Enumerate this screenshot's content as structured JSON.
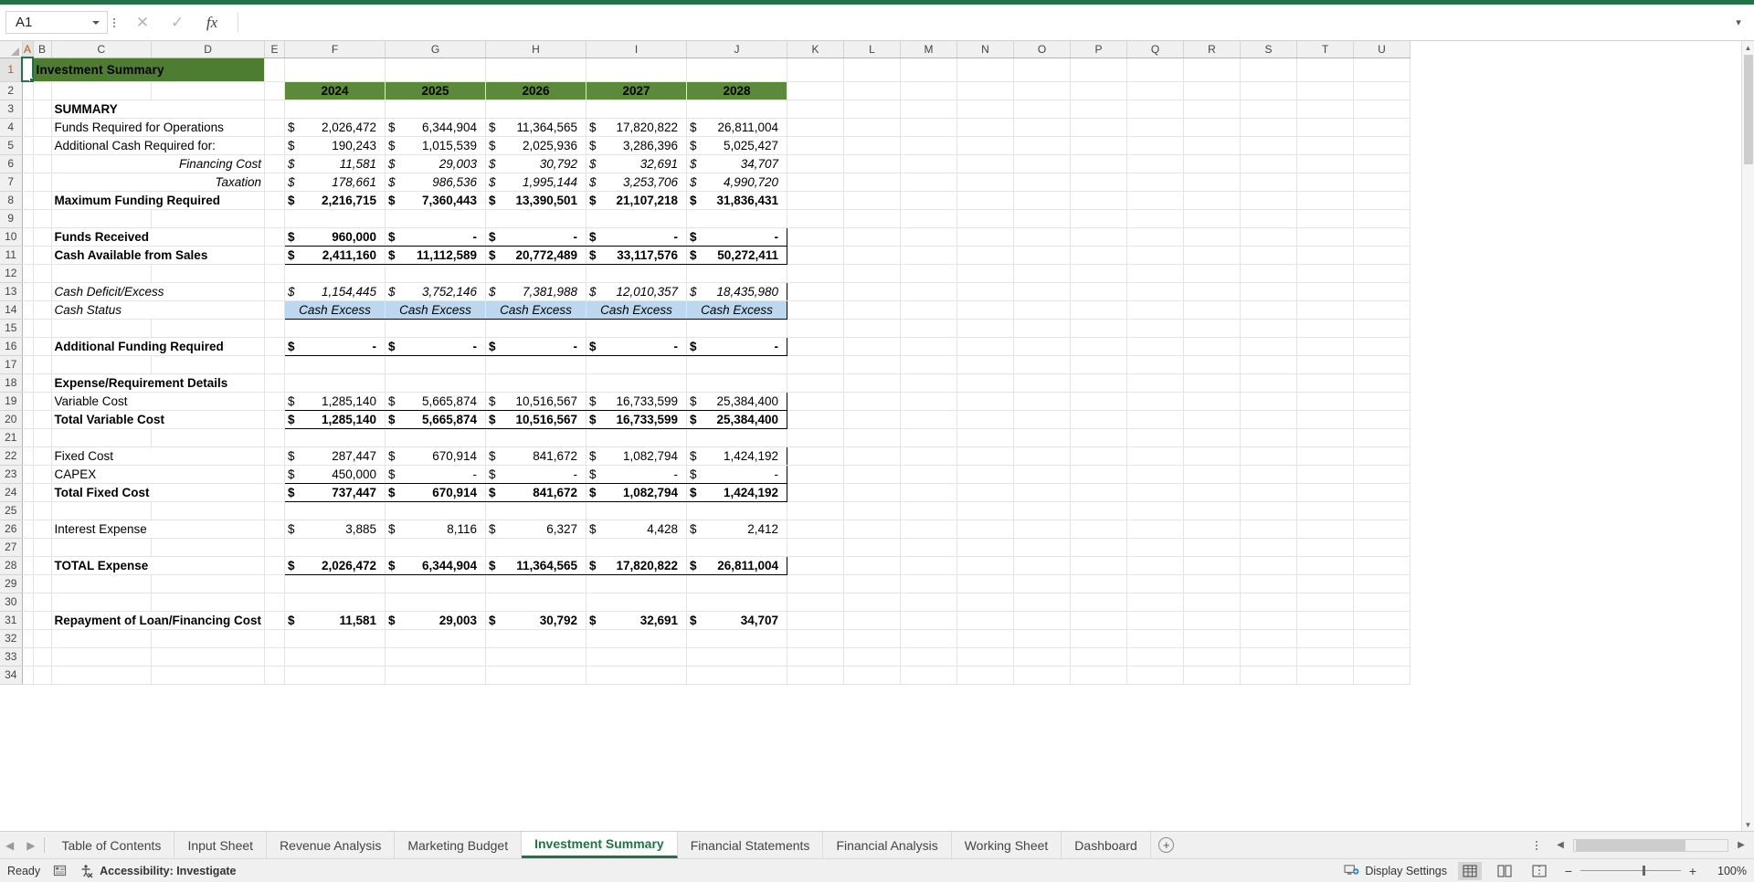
{
  "app": {
    "name_box_value": "A1",
    "formula_value": "",
    "accent_green": "#217346",
    "title_band_green": "#4e7d32",
    "year_band_green": "#5b8b3a",
    "highlight_blue": "#bdd7ee"
  },
  "formula_bar": {
    "cancel_icon": "close-icon",
    "confirm_icon": "check-icon",
    "function_icon": "fx-icon",
    "expand_icon": "chevron-down-icon"
  },
  "columns": [
    "A",
    "B",
    "C",
    "D",
    "E",
    "F",
    "G",
    "H",
    "I",
    "J",
    "K",
    "L",
    "M",
    "N",
    "O",
    "P",
    "Q",
    "R",
    "S",
    "T",
    "U"
  ],
  "rows": [
    1,
    2,
    3,
    4,
    5,
    6,
    7,
    8,
    9,
    10,
    11,
    12,
    13,
    14,
    15,
    16,
    17,
    18,
    19,
    20,
    21,
    22,
    23,
    24,
    25,
    26,
    27,
    28,
    29,
    30,
    31,
    32,
    33,
    34
  ],
  "sheet": {
    "title": "Investment Summary",
    "years": [
      "2024",
      "2025",
      "2026",
      "2027",
      "2028"
    ],
    "sections": [
      {
        "heading": "SUMMARY",
        "rows": [
          {
            "label": "Funds Required for Operations",
            "values": [
              "2,026,472",
              "6,344,904",
              "11,364,565",
              "17,820,822",
              "26,811,004"
            ],
            "style": "normal"
          },
          {
            "label": "Additional Cash Required for:",
            "values": [
              "190,243",
              "1,015,539",
              "2,025,936",
              "3,286,396",
              "5,025,427"
            ],
            "style": "normal"
          },
          {
            "label": "Financing Cost",
            "values": [
              "11,581",
              "29,003",
              "30,792",
              "32,691",
              "34,707"
            ],
            "style": "italic-gray"
          },
          {
            "label": "Taxation",
            "values": [
              "178,661",
              "986,536",
              "1,995,144",
              "3,253,706",
              "4,990,720"
            ],
            "style": "italic-gray"
          },
          {
            "label": "Maximum Funding Required",
            "values": [
              "2,216,715",
              "7,360,443",
              "13,390,501",
              "21,107,218",
              "31,836,431"
            ],
            "style": "bold-total"
          }
        ]
      },
      {
        "heading": "",
        "rows": [
          {
            "label": "Funds Received",
            "values": [
              "960,000",
              "-",
              "-",
              "-",
              "-"
            ],
            "style": "bold-box"
          },
          {
            "label": "Cash Available from Sales",
            "values": [
              "2,411,160",
              "11,112,589",
              "20,772,489",
              "33,117,576",
              "50,272,411"
            ],
            "style": "bold-box"
          }
        ]
      },
      {
        "heading": "",
        "rows": [
          {
            "label": "Cash Deficit/Excess",
            "values": [
              "1,154,445",
              "3,752,146",
              "7,381,988",
              "12,010,357",
              "18,435,980"
            ],
            "style": "italic-gray-box"
          },
          {
            "label": "Cash Status",
            "values": [
              "Cash Excess",
              "Cash Excess",
              "Cash Excess",
              "Cash Excess",
              "Cash Excess"
            ],
            "style": "italic-blue-box"
          }
        ]
      },
      {
        "heading": "",
        "rows": [
          {
            "label": "Additional Funding Required",
            "values": [
              "-",
              "-",
              "-",
              "-",
              "-"
            ],
            "style": "bold-box"
          }
        ]
      },
      {
        "heading": "Expense/Requirement Details",
        "rows": [
          {
            "label": "Variable Cost",
            "values": [
              "1,285,140",
              "5,665,874",
              "10,516,567",
              "16,733,599",
              "25,384,400"
            ],
            "style": "box-top"
          },
          {
            "label": "Total Variable Cost",
            "values": [
              "1,285,140",
              "5,665,874",
              "10,516,567",
              "16,733,599",
              "25,384,400"
            ],
            "style": "bold-box-bottom"
          }
        ]
      },
      {
        "heading": "",
        "rows": [
          {
            "label": "Fixed Cost",
            "values": [
              "287,447",
              "670,914",
              "841,672",
              "1,082,794",
              "1,424,192"
            ],
            "style": "box-top"
          },
          {
            "label": "CAPEX",
            "values": [
              "450,000",
              "-",
              "-",
              "-",
              "-"
            ],
            "style": "box-mid"
          },
          {
            "label": "Total Fixed Cost",
            "values": [
              "737,447",
              "670,914",
              "841,672",
              "1,082,794",
              "1,424,192"
            ],
            "style": "bold-box-bottom"
          }
        ]
      },
      {
        "heading": "",
        "rows": [
          {
            "label": "Interest Expense",
            "values": [
              "3,885",
              "8,116",
              "6,327",
              "4,428",
              "2,412"
            ],
            "style": "normal"
          }
        ]
      },
      {
        "heading": "",
        "rows": [
          {
            "label": "TOTAL Expense",
            "values": [
              "2,026,472",
              "6,344,904",
              "11,364,565",
              "17,820,822",
              "26,811,004"
            ],
            "style": "bold-box"
          }
        ]
      },
      {
        "heading": "",
        "rows": [
          {
            "label": "Repayment of Loan/Financing Cost",
            "values": [
              "11,581",
              "29,003",
              "30,792",
              "32,691",
              "34,707"
            ],
            "style": "bold-plain"
          }
        ]
      }
    ],
    "currency_symbol": "$"
  },
  "tabs": {
    "prev_icon": "chevron-left-icon",
    "next_icon": "chevron-right-icon",
    "items": [
      {
        "label": "Table of Contents",
        "active": false
      },
      {
        "label": "Input Sheet",
        "active": false
      },
      {
        "label": "Revenue Analysis",
        "active": false
      },
      {
        "label": "Marketing Budget",
        "active": false
      },
      {
        "label": "Investment Summary",
        "active": true
      },
      {
        "label": "Financial Statements",
        "active": false
      },
      {
        "label": "Financial Analysis",
        "active": false
      },
      {
        "label": "Working Sheet",
        "active": false
      },
      {
        "label": "Dashboard",
        "active": false
      }
    ],
    "add_sheet_label": "+",
    "overflow_icon": "more-icon"
  },
  "status_bar": {
    "ready_label": "Ready",
    "macro_icon": "record-macro-icon",
    "accessibility_icon": "accessibility-icon",
    "accessibility_label": "Accessibility: Investigate",
    "display_settings_label": "Display Settings",
    "display_settings_icon": "display-settings-icon",
    "view_normal_icon": "normal-view-icon",
    "view_pagelayout_icon": "page-layout-view-icon",
    "view_pagebreak_icon": "page-break-view-icon",
    "zoom_out_label": "−",
    "zoom_in_label": "+",
    "zoom_level": "100%"
  }
}
